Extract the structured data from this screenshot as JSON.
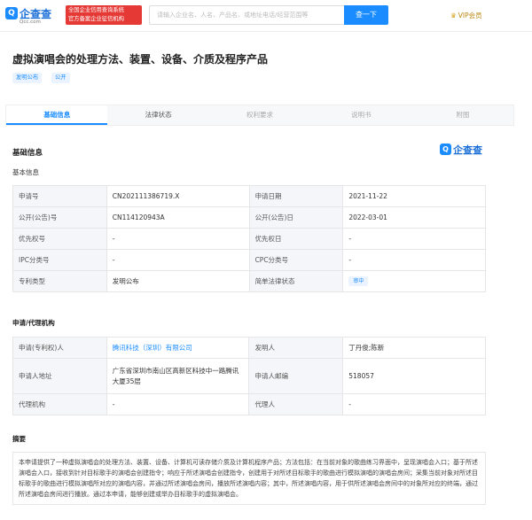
{
  "header": {
    "logo_icon": "Q",
    "logo_text": "企查查",
    "logo_sub": "Qcc.com",
    "cert_line1": "全国企业信用查询系统",
    "cert_line2": "官方备案企业征信机构",
    "search_placeholder": "请输入企业名、人名、产品名、或地址电话/经营范围等",
    "search_button": "查一下",
    "vip_label": "VIP会员",
    "vip_icon": "crown-icon"
  },
  "title": {
    "text": "虚拟演唱会的处理方法、装置、设备、介质及程序产品",
    "tags": [
      "发明公布",
      "公开"
    ]
  },
  "tabs": [
    "基础信息",
    "法律状态",
    "权利要求",
    "说明书",
    "附图"
  ],
  "section_basic": {
    "title": "基础信息",
    "subtitle": "基本信息",
    "brand_icon": "Q",
    "brand_text": "企查查",
    "rows": [
      {
        "l1": "申请号",
        "v1": "CN202111386719.X",
        "l2": "申请日期",
        "v2": "2021-11-22"
      },
      {
        "l1": "公开(公告)号",
        "v1": "CN114120943A",
        "l2": "公开(公告)日",
        "v2": "2022-03-01"
      },
      {
        "l1": "优先权号",
        "v1": "-",
        "l2": "优先权日",
        "v2": "-"
      },
      {
        "l1": "IPC分类号",
        "v1": "-",
        "l2": "CPC分类号",
        "v2": "-"
      },
      {
        "l1": "专利类型",
        "v1": "发明公布",
        "l2": "简单法律状态",
        "v2": "审中"
      }
    ]
  },
  "section_applicant": {
    "title": "申请/代理机构",
    "rows": [
      {
        "l1": "申请(专利权)人",
        "v1": "腾讯科技（深圳）有限公司",
        "l2": "发明人",
        "v2": "丁丹俊;陈新"
      },
      {
        "l1": "申请人地址",
        "v1": "广东省深圳市南山区高新区科技中一路腾讯大厦35层",
        "l2": "申请人邮编",
        "v2": "518057"
      },
      {
        "l1": "代理机构",
        "v1": "-",
        "l2": "代理人",
        "v2": "-"
      }
    ]
  },
  "section_abstract": {
    "title": "摘要",
    "text": "本申请提供了一种虚拟演唱会的处理方法、装置、设备、计算机可读存储介质及计算机程序产品；方法包括：在当前对象的歌曲练习界面中，呈现演唱会入口；基于所述演唱会入口，接收到针对目标歌手的演唱会创建指令；响应于所述演唱会创建指令，创建用于对所述目标歌手的歌曲进行模拟演唱的演唱会房间；采集当前对象对所述目标歌手的歌曲进行模拟演唱所对应的演唱内容，并通过所述演唱会房间，播放所述演唱内容；其中，所述演唱内容，用于供所述演唱会房间中的对象所对应的终端，通过所述演唱会房间进行播放。通过本申请，能够创建或举办目标歌手的虚拟演唱会。"
  }
}
